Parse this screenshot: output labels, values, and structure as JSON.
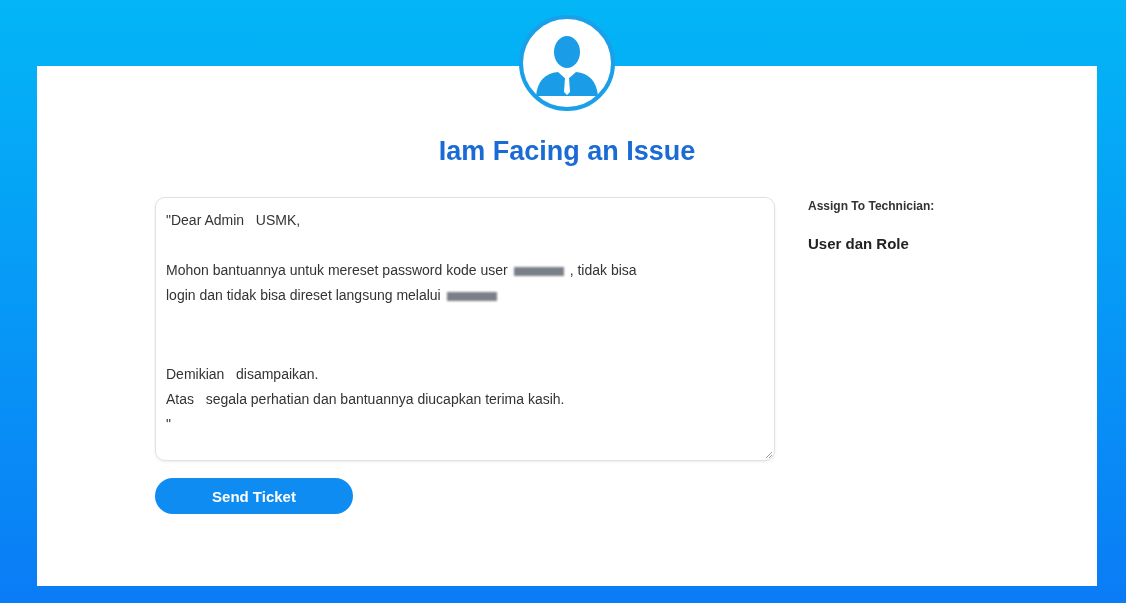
{
  "title": "Iam Facing an Issue",
  "message": {
    "paragraphs": [
      [
        [
          {
            "kind": "text",
            "text": "\"Dear Admin   USMK,"
          }
        ]
      ],
      [
        [
          {
            "kind": "text",
            "text": "Mohon bantuannya untuk mereset password kode user"
          },
          {
            "kind": "redacted"
          },
          {
            "kind": "text",
            "text": ", tidak bisa"
          }
        ],
        [
          {
            "kind": "text",
            "text": "login dan tidak bisa direset langsung melalui"
          },
          {
            "kind": "redacted"
          }
        ]
      ],
      [
        [
          {
            "kind": "text",
            "text": "Demikian   disampaikan."
          }
        ],
        [
          {
            "kind": "text",
            "text": "Atas   segala perhatian dan bantuannya diucapkan terima kasih."
          }
        ],
        [
          {
            "kind": "text",
            "text": "\""
          }
        ]
      ]
    ]
  },
  "assign": {
    "label": "Assign To Technician:",
    "value": "User dan Role"
  },
  "button": "Send Ticket"
}
